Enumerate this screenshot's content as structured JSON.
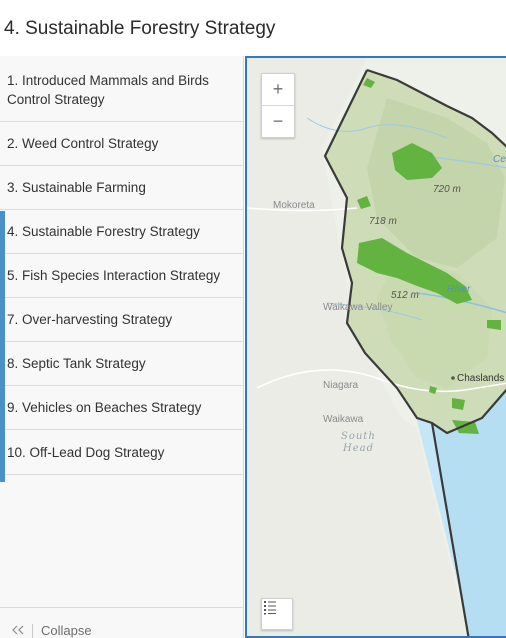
{
  "page": {
    "title": "4. Sustainable Forestry Strategy"
  },
  "sidebar": {
    "items": [
      {
        "label": "1. Introduced Mammals and Birds Control Strategy"
      },
      {
        "label": "2. Weed Control Strategy"
      },
      {
        "label": "3. Sustainable Farming"
      },
      {
        "label": "4. Sustainable Forestry Strategy"
      },
      {
        "label": "5. Fish Species Interaction Strategy"
      },
      {
        "label": "7. Over-harvesting Strategy"
      },
      {
        "label": "8. Septic Tank Strategy"
      },
      {
        "label": "9. Vehicles on Beaches Strategy"
      },
      {
        "label": "10. Off-Lead Dog Strategy"
      }
    ],
    "collapse": {
      "icon": "double-chevron-left-icon",
      "label": "Collapse"
    }
  },
  "map": {
    "zoom_in_label": "+",
    "zoom_out_label": "−",
    "legend_icon": "list-icon",
    "labels": {
      "mokoreta": "Mokoreta",
      "waikawa_valley": "Waikawa Valley",
      "niagara": "Niagara",
      "waikawa": "Waikawa",
      "chaslands": "Chaslands",
      "south": "South",
      "head": "Head",
      "river": "River",
      "cee": "Cee",
      "elev_720": "720 m",
      "elev_718": "718 m",
      "elev_512": "512 m"
    },
    "colors": {
      "accent": "#2f7bc1",
      "forestry": "#62b33f",
      "sea": "#c5e6f6",
      "boundary": "#3a3a3a"
    }
  }
}
